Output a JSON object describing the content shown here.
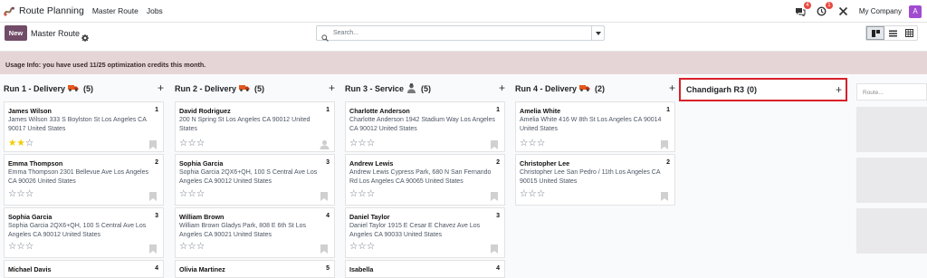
{
  "nav": {
    "app_name": "Route Planning",
    "menu": [
      "Master Route",
      "Jobs"
    ],
    "messages_badge": "4",
    "activity_badge": "1",
    "company": "My Company",
    "avatar_letter": "A"
  },
  "control": {
    "new_label": "New",
    "title": "Master Route",
    "search_placeholder": "Search..."
  },
  "info_text": "Usage Info: you have used 11/25 optimization credits this month.",
  "columns": [
    {
      "title": "Run 1 - Delivery",
      "icon": "truck-icon",
      "count": "(5)",
      "cards": [
        {
          "name": "James Wilson",
          "seq": "1",
          "address": "James Wilson 333 S Boylston St Los Angeles CA 90017 United States",
          "rating": 2,
          "extra": "bookmark-icon"
        },
        {
          "name": "Emma Thompson",
          "seq": "2",
          "address": "Emma Thompson 2301 Bellevue Ave Los Angeles CA 90026 United States",
          "rating": 0,
          "extra": "bookmark-icon"
        },
        {
          "name": "Sophia Garcia",
          "seq": "3",
          "address": "Sophia Garcia 2QX6+QH, 100 S Central Ave Los Angeles CA 90012 United States",
          "rating": 0,
          "extra": "bookmark-icon"
        },
        {
          "name": "Michael Davis",
          "seq": "4",
          "address": "",
          "rating": 0,
          "extra": ""
        }
      ]
    },
    {
      "title": "Run 2 - Delivery",
      "icon": "truck-icon",
      "count": "(5)",
      "cards": [
        {
          "name": "David Rodriguez",
          "seq": "1",
          "address": "200 N Spring St Los Angeles CA 90012 United States",
          "rating": 0,
          "extra": "user-icon"
        },
        {
          "name": "Sophia Garcia",
          "seq": "3",
          "address": "Sophia Garcia 2QX6+QH, 100 S Central Ave Los Angeles CA 90012 United States",
          "rating": 0,
          "extra": "bookmark-icon"
        },
        {
          "name": "William Brown",
          "seq": "4",
          "address": "William Brown Gladys Park, 808 E 6th St Los Angeles CA 90021 United States",
          "rating": 0,
          "extra": "bookmark-icon"
        },
        {
          "name": "Olivia Martinez",
          "seq": "5",
          "address": "",
          "rating": 0,
          "extra": ""
        }
      ]
    },
    {
      "title": "Run 3 - Service",
      "icon": "technician-icon",
      "count": "(5)",
      "cards": [
        {
          "name": "Charlotte Anderson",
          "seq": "1",
          "address": "Charlotte Anderson 1942 Stadium Way Los Angeles CA 90012 United States",
          "rating": 0,
          "extra": "bookmark-icon"
        },
        {
          "name": "Andrew Lewis",
          "seq": "2",
          "address": "Andrew Lewis Cypress Park, 680 N San Fernando Rd Los Angeles CA 90065 United States",
          "rating": 0,
          "extra": "bookmark-icon"
        },
        {
          "name": "Daniel Taylor",
          "seq": "3",
          "address": "Daniel Taylor 1915 E Cesar E Chavez Ave Los Angeles CA 90033 United States",
          "rating": 0,
          "extra": "bookmark-icon"
        },
        {
          "name": "Isabella",
          "seq": "4",
          "address": "",
          "rating": 0,
          "extra": ""
        }
      ]
    },
    {
      "title": "Run 4 - Delivery",
      "icon": "truck-icon",
      "count": "(2)",
      "cards": [
        {
          "name": "Amelia White",
          "seq": "1",
          "address": "Amelia White 416 W 8th St Los Angeles CA 90014 United States",
          "rating": 0,
          "extra": "bookmark-icon"
        },
        {
          "name": "Christopher Lee",
          "seq": "2",
          "address": "Christopher Lee San Pedro / 11th Los Angeles CA 90015 United States",
          "rating": 0,
          "extra": "bookmark-icon"
        }
      ]
    }
  ],
  "new_column": {
    "title": "Chandigarh R3",
    "count": "(0)"
  },
  "quick_create": {
    "placeholder": "Route..."
  }
}
